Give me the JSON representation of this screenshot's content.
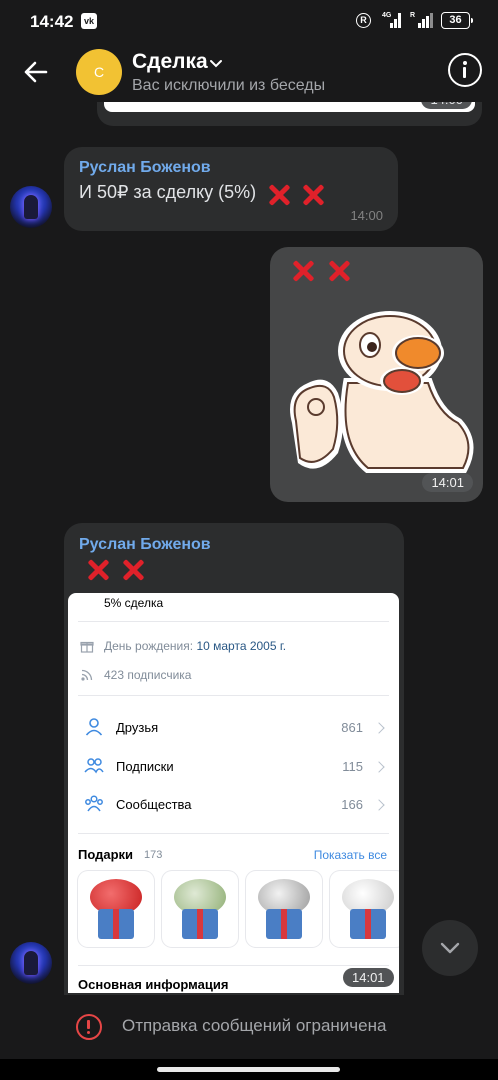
{
  "status_bar": {
    "time": "14:42",
    "app_icon": "vk-icon",
    "network": "4G",
    "battery": "36"
  },
  "header": {
    "avatar_letter": "С",
    "title": "Сделка",
    "subtitle": "Вас исключили из беседы",
    "back_icon": "arrow-left-icon",
    "info_icon": "info-icon"
  },
  "messages": [
    {
      "sender": "Руслан Боженов",
      "text": "И 50₽ за сделку (5%)",
      "time": "14:00"
    },
    {
      "type": "sticker",
      "time": "14:01"
    },
    {
      "sender": "Руслан Боженов",
      "time": "14:01",
      "screenshot": {
        "status": "5% сделка",
        "birthday_label": "День рождения:",
        "birthday_value": "10 марта 2005 г.",
        "followers": "423 подписчика",
        "menu": [
          {
            "label": "Друзья",
            "count": "861"
          },
          {
            "label": "Подписки",
            "count": "115"
          },
          {
            "label": "Сообщества",
            "count": "166"
          }
        ],
        "gifts_title": "Подарки",
        "gifts_count": "173",
        "show_all": "Показать все",
        "basic_info": "Основная информация"
      }
    }
  ],
  "footer": {
    "restricted_text": "Отправка сообщений ограничена"
  },
  "colors": {
    "background": "#19191a",
    "bubble": "#2c2d2e",
    "sender": "#71aaeb",
    "cross": "#e0212a",
    "avatar_chat": "#f2c233"
  }
}
